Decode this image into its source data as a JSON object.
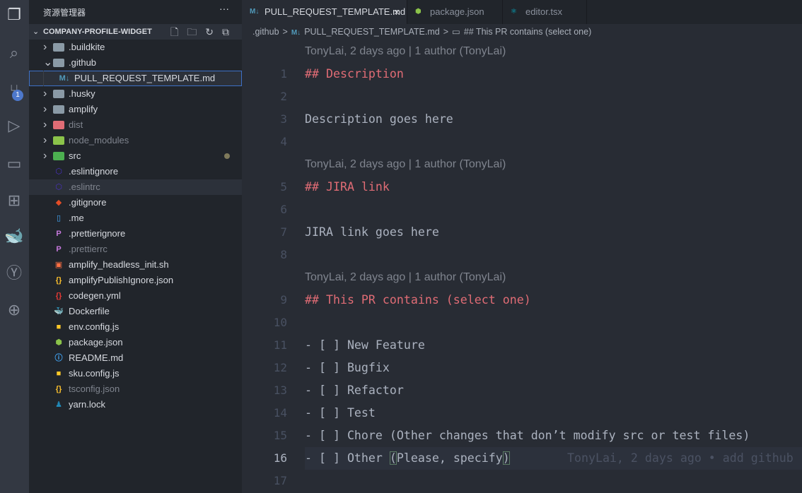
{
  "activity": {
    "scm_badge": "1",
    "icons": [
      "explorer-icon",
      "search-icon",
      "source-control-icon",
      "run-debug-icon",
      "remote-explorer-icon",
      "extensions-icon",
      "docker-icon",
      "git-graph-icon",
      "network-icon"
    ]
  },
  "sidebar": {
    "title": "资源管理器",
    "more": "···",
    "project": "COMPANY-PROFILE-WIDGET",
    "items": [
      {
        "label": ".buildkite",
        "type": "folder",
        "color": "#8a9aa6",
        "icon": "▰"
      },
      {
        "label": ".github",
        "type": "folder-open",
        "color": "#8a9aa6",
        "icon": "▰"
      },
      {
        "label": "PULL_REQUEST_TEMPLATE.md",
        "type": "child",
        "color": "#519aba",
        "icon": "M↓",
        "selected": true
      },
      {
        "label": ".husky",
        "type": "folder",
        "color": "#8a9aa6",
        "icon": "▰"
      },
      {
        "label": "amplify",
        "type": "folder",
        "color": "#8a9aa6",
        "icon": "▰"
      },
      {
        "label": "dist",
        "type": "folder",
        "color": "#e06c75",
        "icon": "▰",
        "dim": true
      },
      {
        "label": "node_modules",
        "type": "folder",
        "color": "#8bc34a",
        "icon": "▰",
        "dim": true
      },
      {
        "label": "src",
        "type": "folder",
        "color": "#4caf50",
        "icon": "▰",
        "modified": true
      },
      {
        "label": ".eslintignore",
        "type": "file",
        "color": "#4b32c3",
        "icon": "⬡"
      },
      {
        "label": ".eslintrc",
        "type": "file",
        "color": "#4b32c3",
        "icon": "⬡",
        "dim": true,
        "hover": true
      },
      {
        "label": ".gitignore",
        "type": "file",
        "color": "#e44d26",
        "icon": "◆"
      },
      {
        "label": ".me",
        "type": "file",
        "color": "#42a5f5",
        "icon": "▯"
      },
      {
        "label": ".prettierignore",
        "type": "file",
        "color": "#c678dd",
        "icon": "P"
      },
      {
        "label": ".prettierrc",
        "type": "file",
        "color": "#c678dd",
        "icon": "P",
        "dim": true
      },
      {
        "label": "amplify_headless_init.sh",
        "type": "file",
        "color": "#ff7043",
        "icon": "▣"
      },
      {
        "label": "amplifyPublishIgnore.json",
        "type": "file",
        "color": "#fbc02d",
        "icon": "{}"
      },
      {
        "label": "codegen.yml",
        "type": "file",
        "color": "#e53935",
        "icon": "{}"
      },
      {
        "label": "Dockerfile",
        "type": "file",
        "color": "#0288d1",
        "icon": "🐳"
      },
      {
        "label": "env.config.js",
        "type": "file",
        "color": "#ffca28",
        "icon": "■"
      },
      {
        "label": "package.json",
        "type": "file",
        "color": "#8bc34a",
        "icon": "⬢"
      },
      {
        "label": "README.md",
        "type": "file",
        "color": "#42a5f5",
        "icon": "ⓘ"
      },
      {
        "label": "sku.config.js",
        "type": "file",
        "color": "#ffca28",
        "icon": "■"
      },
      {
        "label": "tsconfig.json",
        "type": "file",
        "color": "#fbc02d",
        "icon": "{}",
        "dim": true
      },
      {
        "label": "yarn.lock",
        "type": "file",
        "color": "#2188b6",
        "icon": "♟"
      }
    ]
  },
  "tabs": [
    {
      "label": "PULL_REQUEST_TEMPLATE.md",
      "icon": "M↓",
      "color": "#519aba",
      "active": true,
      "close": "×"
    },
    {
      "label": "package.json",
      "icon": "⬢",
      "color": "#8bc34a"
    },
    {
      "label": "editor.tsx",
      "icon": "⚛",
      "color": "#00bcd4"
    }
  ],
  "breadcrumb": [
    ".github",
    ">",
    "M↓",
    "PULL_REQUEST_TEMPLATE.md",
    ">",
    "▭",
    "## This PR contains (select one)"
  ],
  "editor": {
    "lens": "TonyLai, 2 days ago | 1 author (TonyLai)",
    "blame": "TonyLai, 2 days ago • add github",
    "lines": [
      {
        "lens": true
      },
      {
        "n": "1",
        "t": "## Description",
        "h": true
      },
      {
        "n": "2",
        "t": ""
      },
      {
        "n": "3",
        "t": "Description goes here"
      },
      {
        "n": "4",
        "t": ""
      },
      {
        "lens": true
      },
      {
        "n": "5",
        "t": "## JIRA link",
        "h": true
      },
      {
        "n": "6",
        "t": ""
      },
      {
        "n": "7",
        "t": "JIRA link goes here"
      },
      {
        "n": "8",
        "t": ""
      },
      {
        "lens": true
      },
      {
        "n": "9",
        "t": "## This PR contains (select one)",
        "h": true
      },
      {
        "n": "10",
        "t": ""
      },
      {
        "n": "11",
        "t": "- [ ] New Feature"
      },
      {
        "n": "12",
        "t": "- [ ] Bugfix"
      },
      {
        "n": "13",
        "t": "- [ ] Refactor"
      },
      {
        "n": "14",
        "t": "- [ ] Test"
      },
      {
        "n": "15",
        "t": "- [ ] Chore (Other changes that don’t modify src or test files)"
      },
      {
        "n": "16",
        "t": "- [ ] Other (Please, specify)",
        "current": true
      },
      {
        "n": "17",
        "t": ""
      }
    ]
  }
}
